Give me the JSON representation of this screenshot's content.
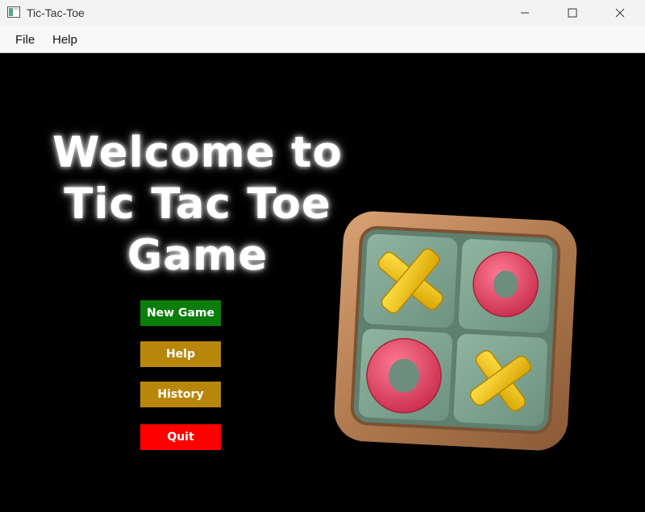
{
  "window": {
    "title": "Tic-Tac-Toe",
    "icons": {
      "app": "window-app-icon",
      "minimize": "minimize-icon",
      "maximize": "maximize-icon",
      "close": "close-icon"
    }
  },
  "menubar": {
    "items": [
      {
        "label": "File"
      },
      {
        "label": "Help"
      }
    ]
  },
  "main": {
    "heading_lines": [
      "Welcome to",
      "Tic Tac Toe",
      "Game"
    ],
    "buttons": {
      "new_game": "New Game",
      "help": "Help",
      "history": "History",
      "quit": "Quit"
    },
    "colors": {
      "background": "#000000",
      "new_game": "#0a7d0a",
      "help": "#b8860b",
      "history": "#b8860b",
      "quit": "#ff0000",
      "board_frame": "#b07a4f",
      "tile": "#7fa48f",
      "x_piece": "#f2c318",
      "o_piece": "#e0405e"
    },
    "board_image": {
      "icon": "tic-tac-toe-board-image",
      "cells": [
        "X",
        "O",
        "O",
        "X"
      ]
    }
  }
}
